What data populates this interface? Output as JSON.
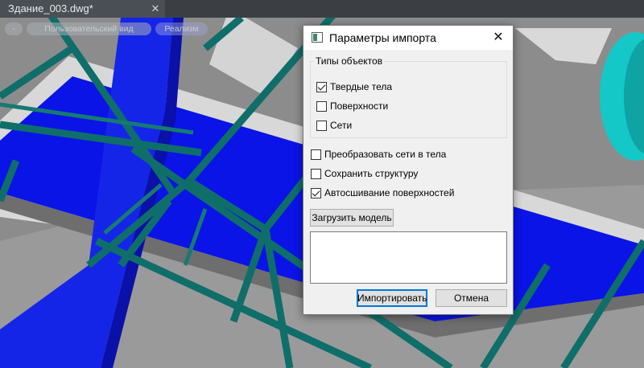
{
  "colors": {
    "viewport_bg": "#8c8c8c",
    "slab_blue": "#0a14e6",
    "beam_teal": "#0f6e6a",
    "tank_cyan": "#14c8c8",
    "accent": "#0078d7"
  },
  "editor": {
    "tab": {
      "label": "Здание_003.dwg*",
      "close_glyph": "✕"
    },
    "viewbar": {
      "minus_label": "-",
      "mode_label": "Пользовательский вид",
      "render_label": "Реализм"
    }
  },
  "dialog": {
    "title": "Параметры импорта",
    "close_glyph": "✕",
    "icon": "window-icon",
    "object_types": {
      "title": "Типы объектов",
      "items": [
        {
          "label": "Твердые тела",
          "checked": true
        },
        {
          "label": "Поверхности",
          "checked": false
        },
        {
          "label": "Сети",
          "checked": false
        }
      ]
    },
    "options": [
      {
        "label": "Преобразовать сети в тела",
        "checked": false
      },
      {
        "label": "Сохранить структуру",
        "checked": false
      },
      {
        "label": "Автосшивание поверхностей",
        "checked": true
      }
    ],
    "load_model_label": "Загрузить модель",
    "log_text": "",
    "import_label": "Импортировать",
    "cancel_label": "Отмена"
  }
}
